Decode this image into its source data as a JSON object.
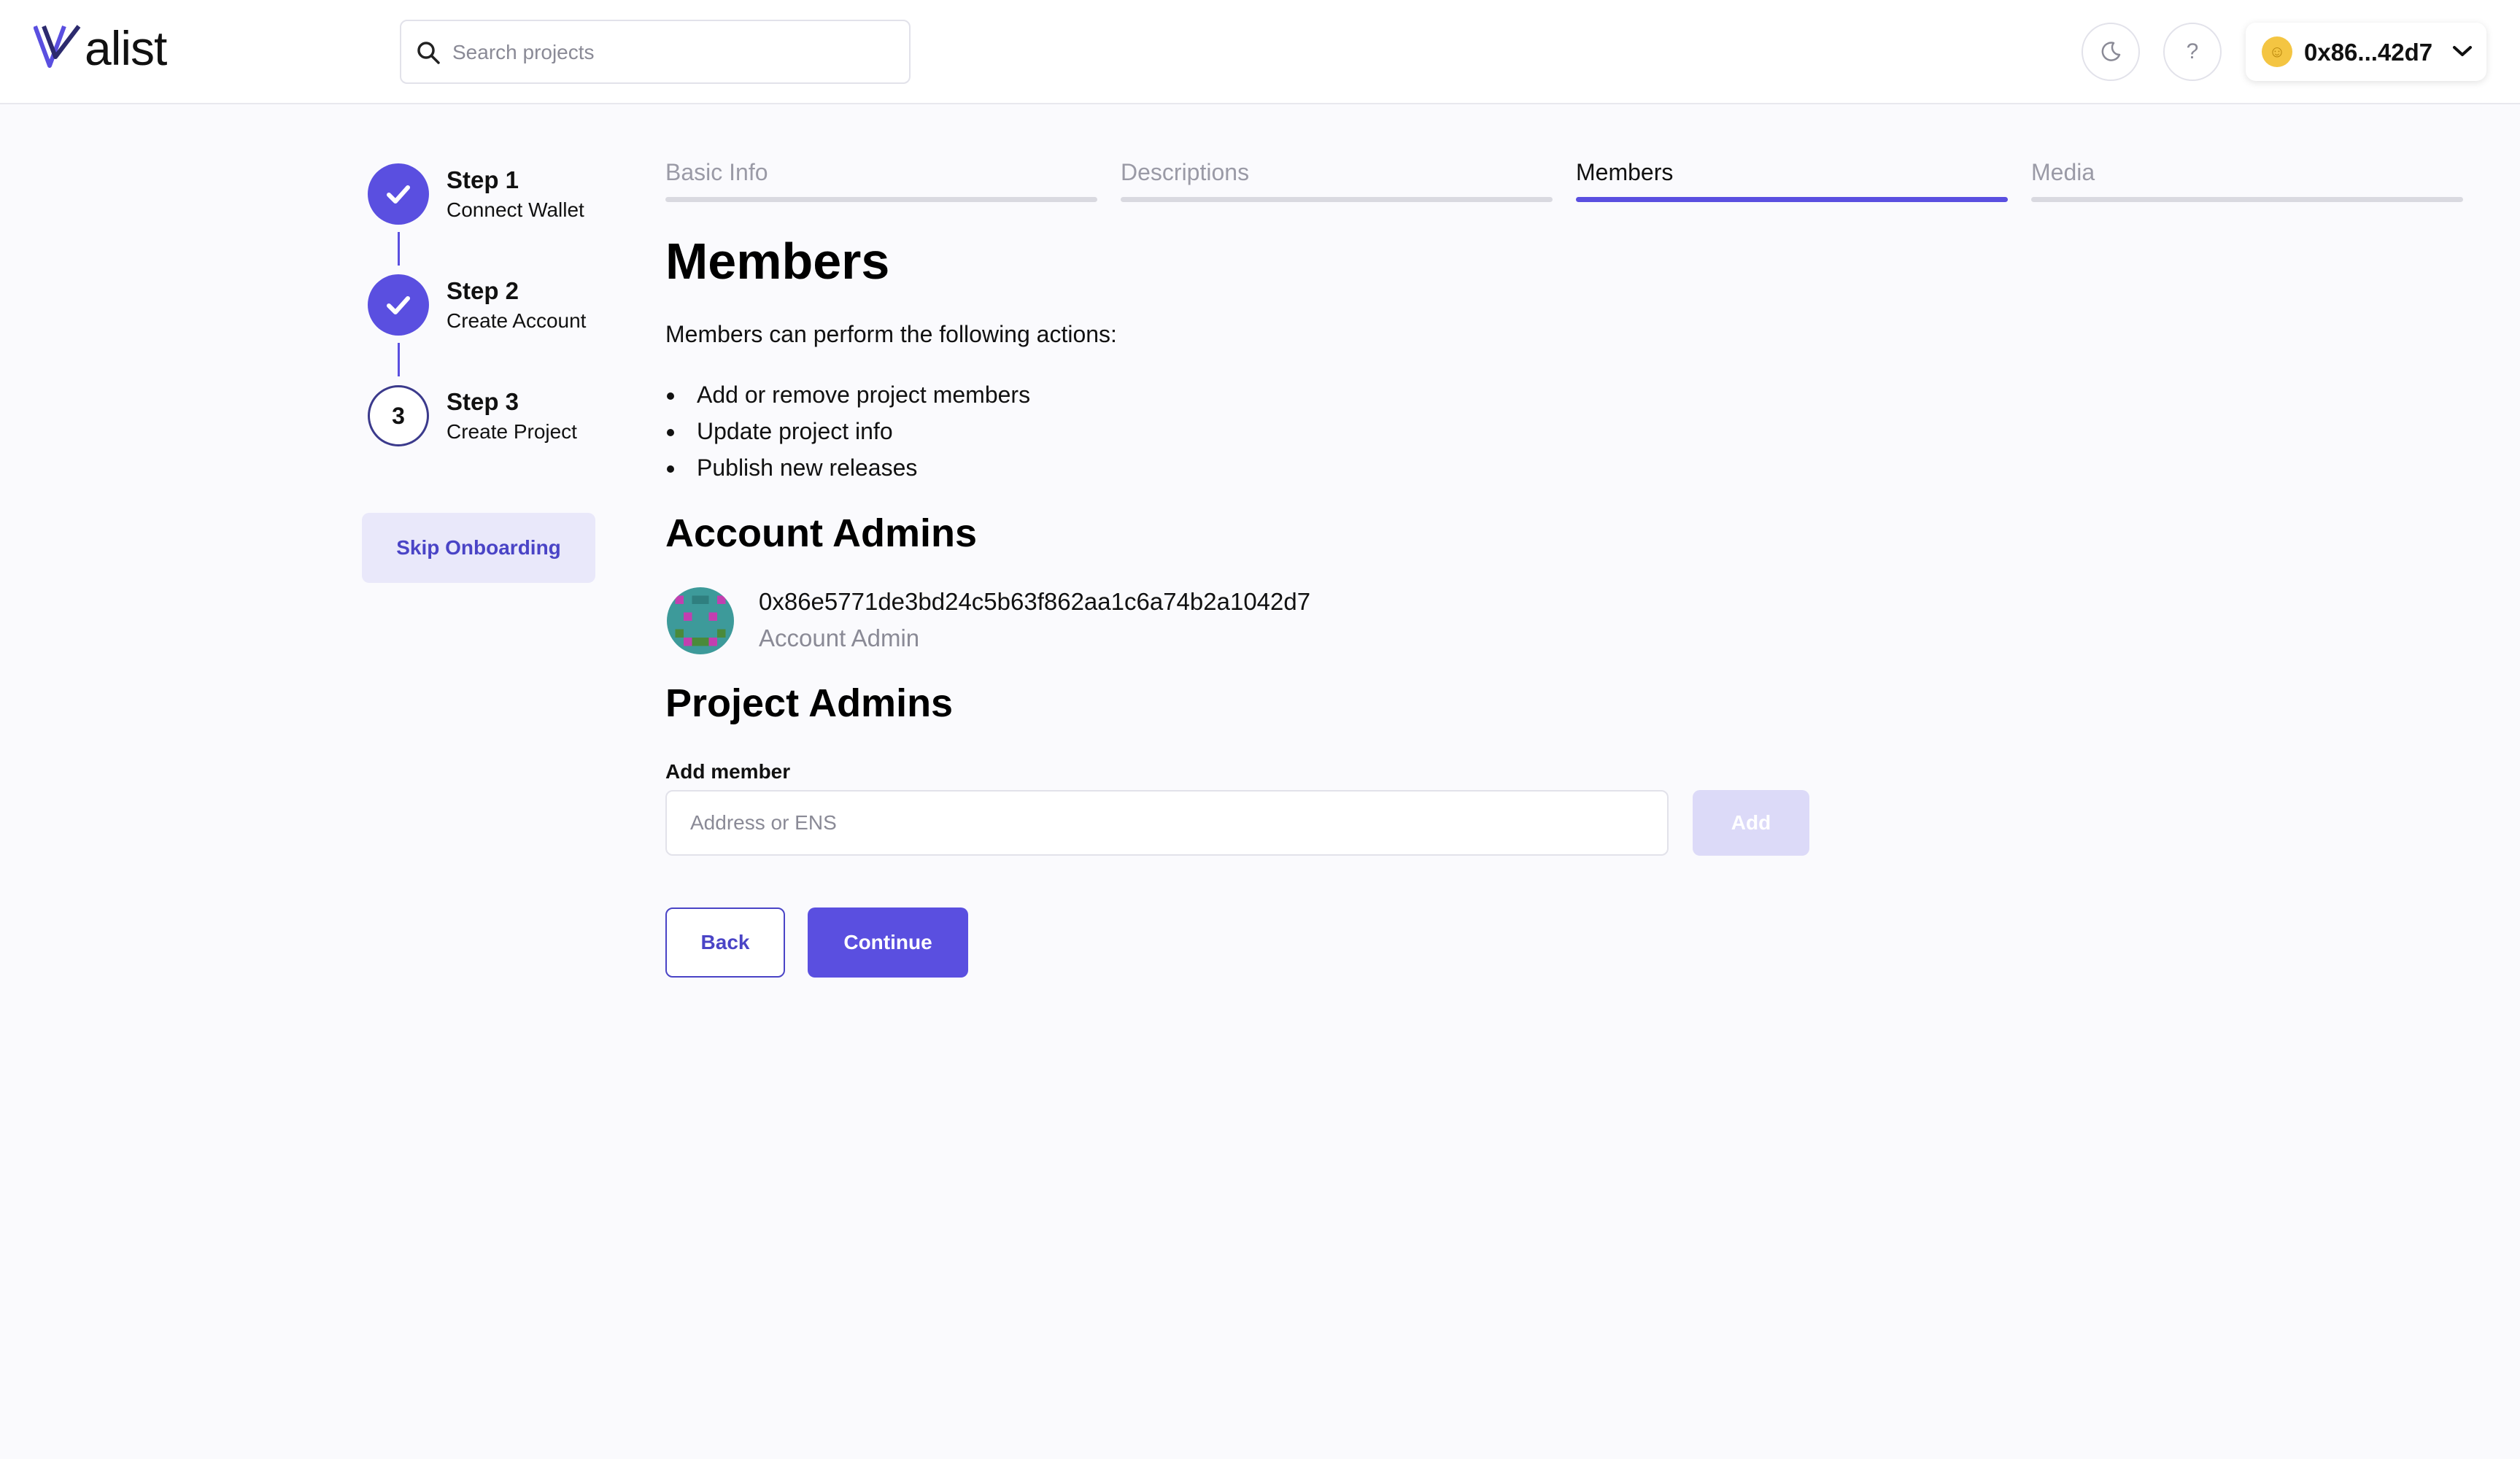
{
  "header": {
    "logo_text": "alist",
    "logo_icon": "valist-v-logo",
    "search_placeholder": "Search projects",
    "theme_icon": "moon-icon",
    "help_label": "?",
    "wallet_address": "0x86...42d7"
  },
  "stepper": {
    "steps": [
      {
        "title": "Step 1",
        "subtitle": "Connect Wallet",
        "status": "done"
      },
      {
        "title": "Step 2",
        "subtitle": "Create Account",
        "status": "done"
      },
      {
        "title": "Step 3",
        "subtitle": "Create Project",
        "status": "current",
        "number": "3"
      }
    ],
    "skip_label": "Skip Onboarding"
  },
  "tabs": [
    {
      "label": "Basic Info",
      "active": false
    },
    {
      "label": "Descriptions",
      "active": false
    },
    {
      "label": "Members",
      "active": true
    },
    {
      "label": "Media",
      "active": false
    }
  ],
  "main": {
    "title": "Members",
    "intro": "Members can perform the following actions:",
    "actions": [
      "Add or remove project members",
      "Update project info",
      "Publish new releases"
    ],
    "account_admins_heading": "Account Admins",
    "account_admin": {
      "address": "0x86e5771de3bd24c5b63f862aa1c6a74b2a1042d7",
      "role": "Account Admin"
    },
    "project_admins_heading": "Project Admins",
    "add_member_label": "Add member",
    "add_member_placeholder": "Address or ENS",
    "add_label": "Add",
    "back_label": "Back",
    "continue_label": "Continue"
  },
  "colors": {
    "accent": "#5a4fe0",
    "accent_text": "#4a44c6",
    "accent_light": "#e9e8fa",
    "background": "#fafafd"
  }
}
